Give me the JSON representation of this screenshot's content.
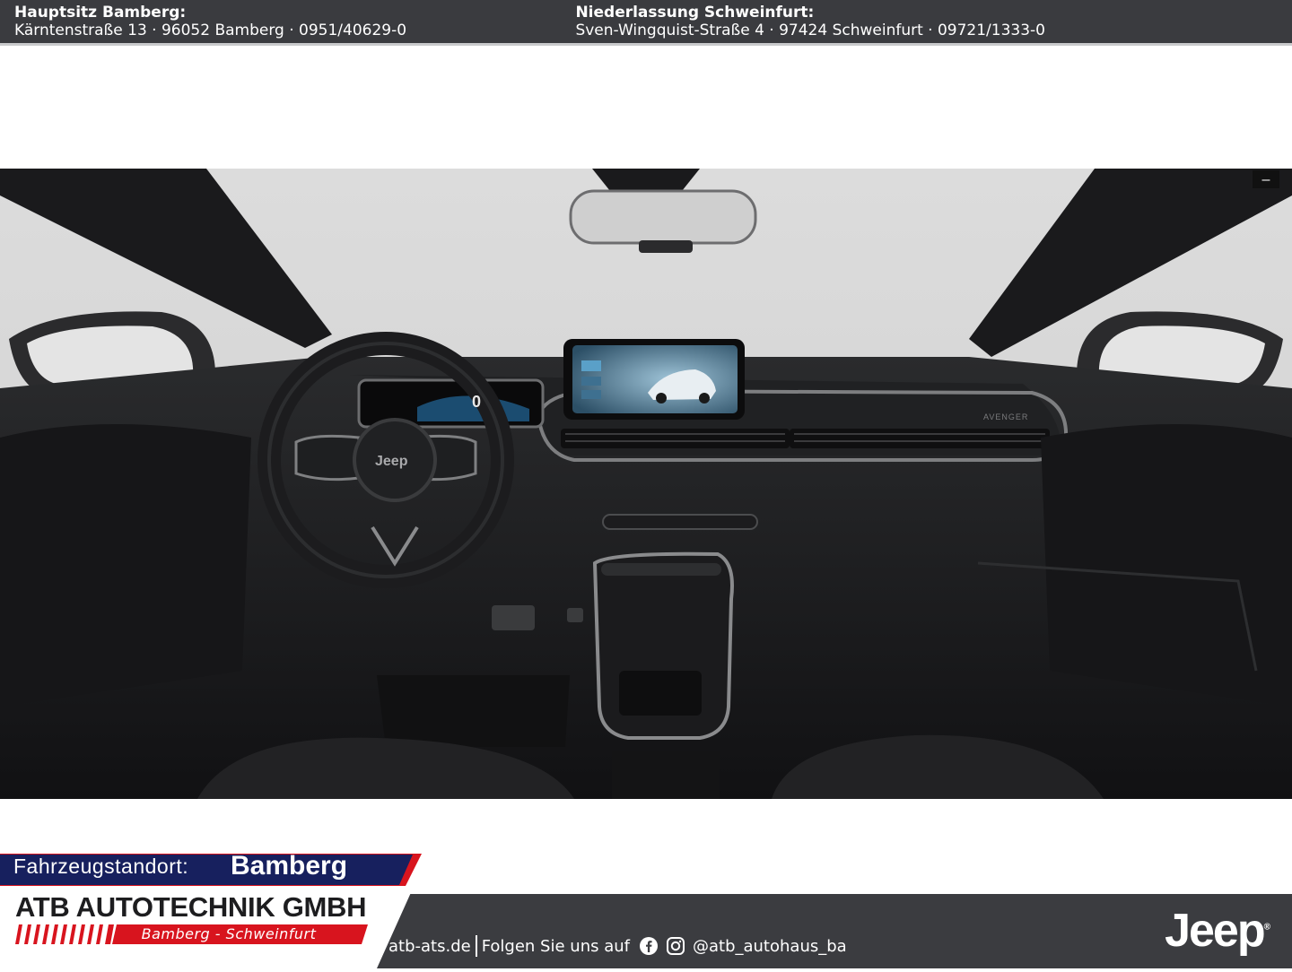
{
  "topbar": {
    "hq_label": "Hauptsitz Bamberg:",
    "hq_address": "Kärntenstraße 13 · 96052 Bamberg · 0951/40629-0",
    "branch_label": "Niederlassung Schweinfurt:",
    "branch_address": "Sven-Wingquist-Straße 4 · 97424 Schweinfurt · 09721/1333-0"
  },
  "photo": {
    "zoom_label": "–",
    "steering_badge": "Jeep",
    "cluster_speed": "0",
    "dash_badge": "AVENGER"
  },
  "location": {
    "label": "Fahrzeugstandort:",
    "value": "Bamberg"
  },
  "company": {
    "name": "ATB AUTOTECHNIK GMBH",
    "cities": "Bamberg - Schweinfurt"
  },
  "footer": {
    "website": "atb-ats.de",
    "follow": "Folgen Sie uns auf",
    "handle": "@atb_autohaus_ba",
    "brand": "Jeep",
    "brand_mark": "®",
    "icons": [
      "facebook-icon",
      "instagram-icon"
    ],
    "colors": {
      "navy": "#17205e",
      "red": "#d8141e",
      "dark": "#3b3c40"
    }
  }
}
